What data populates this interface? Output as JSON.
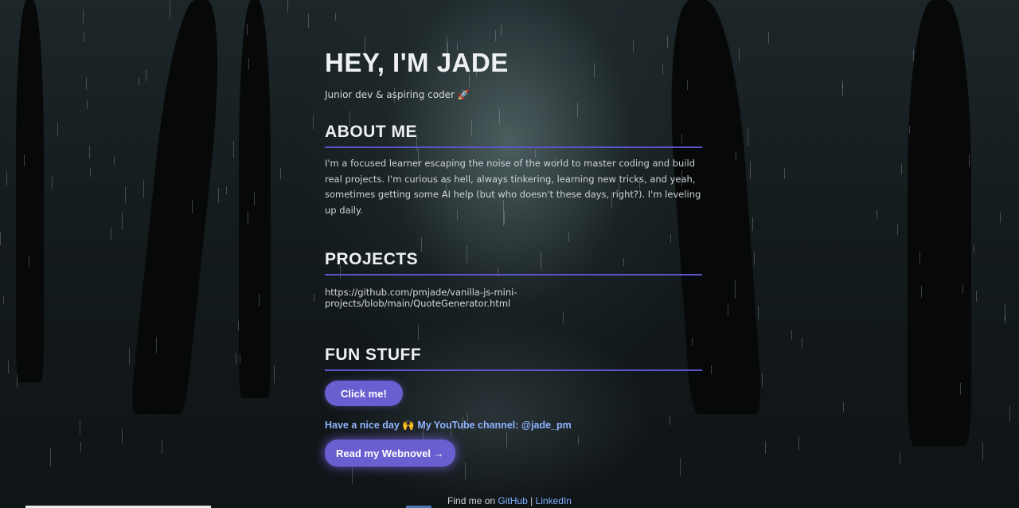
{
  "header": {
    "title": "HEY, I'M JADE",
    "tagline": "Junior dev & aspiring coder 🚀"
  },
  "about": {
    "title": "ABOUT ME",
    "text": "I'm a focused learner escaping the noise of the world to master coding and build real projects. I'm curious as hell, always tinkering, learning new tricks, and yeah, sometimes getting some AI help (but who doesn't these days, right?). I'm leveling up daily."
  },
  "projects": {
    "title": "PROJECTS",
    "link": "https://github.com/pmjade/vanilla-js-mini-projects/blob/main/QuoteGenerator.html"
  },
  "fun": {
    "title": "FUN STUFF",
    "button_label": "Click me!",
    "message": "Have a nice day 🙌 My YouTube channel: @jade_pm",
    "webnovel_label": "Read my Webnovel →"
  },
  "footer": {
    "prefix": "Find me on",
    "github": "GitHub",
    "separator": "|",
    "linkedin": "LinkedIn"
  },
  "colors": {
    "accent": "#6a5fd0",
    "link": "#8fb4ff",
    "divider": "#5b56c8"
  }
}
